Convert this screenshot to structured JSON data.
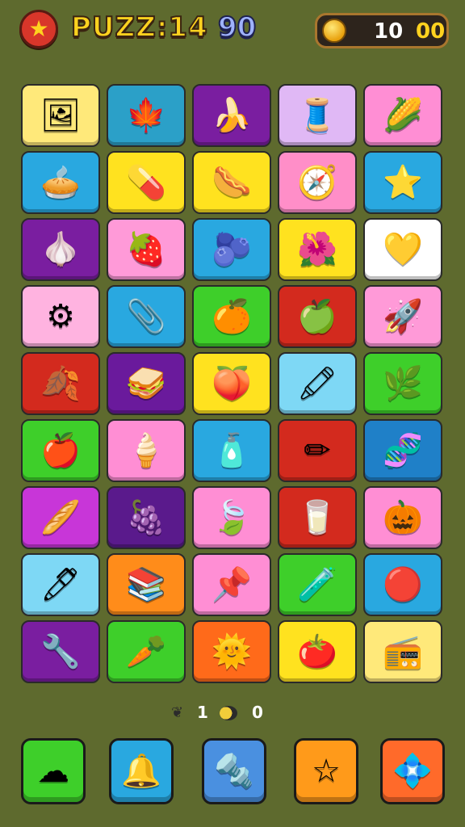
{
  "header": {
    "title": "PUZZ:14",
    "level": "90",
    "coins_main": "10",
    "coins_extra": "00",
    "badge_icon": "★"
  },
  "grid": [
    [
      {
        "icon": "picture-frame-icon",
        "glyph": "🖼",
        "bg": "#ffe97a"
      },
      {
        "icon": "red-leaf-icon",
        "glyph": "🍁",
        "bg": "#2ba0c8"
      },
      {
        "icon": "banana-icon",
        "glyph": "🍌",
        "bg": "#7a1ea0"
      },
      {
        "icon": "rolling-pin-icon",
        "glyph": "🧵",
        "bg": "#e0b8f5"
      },
      {
        "icon": "corn-icon",
        "glyph": "🌽",
        "bg": "#ff8ed4"
      }
    ],
    [
      {
        "icon": "pie-icon",
        "glyph": "🥧",
        "bg": "#29a8e0"
      },
      {
        "icon": "capsule-icon",
        "glyph": "💊",
        "bg": "#ffe21f"
      },
      {
        "icon": "sausage-icon",
        "glyph": "🌭",
        "bg": "#ffe21f"
      },
      {
        "icon": "compass-icon",
        "glyph": "🧭",
        "bg": "#ff8ec8"
      },
      {
        "icon": "star-icon",
        "glyph": "⭐",
        "bg": "#29a8e0"
      }
    ],
    [
      {
        "icon": "garlic-icon",
        "glyph": "🧄",
        "bg": "#7a1ea0"
      },
      {
        "icon": "berry-plate-icon",
        "glyph": "🍓",
        "bg": "#ff9ad8"
      },
      {
        "icon": "berries-branch-icon",
        "glyph": "🫐",
        "bg": "#29a8e0"
      },
      {
        "icon": "flower-icon",
        "glyph": "🌺",
        "bg": "#ffe21f"
      },
      {
        "icon": "heart-icon",
        "glyph": "💛",
        "bg": "#ffffff"
      }
    ],
    [
      {
        "icon": "gear-icon",
        "glyph": "⚙",
        "bg": "#ffb3e0"
      },
      {
        "icon": "stapler-icon",
        "glyph": "📎",
        "bg": "#29a8e0"
      },
      {
        "icon": "orange-icon",
        "glyph": "🍊",
        "bg": "#3ecf2a"
      },
      {
        "icon": "apple-icon",
        "glyph": "🍏",
        "bg": "#d32a1e"
      },
      {
        "icon": "rocket-icon",
        "glyph": "🚀",
        "bg": "#ff9ad8"
      }
    ],
    [
      {
        "icon": "leaf-icon",
        "glyph": "🍂",
        "bg": "#d32a1e"
      },
      {
        "icon": "sandwich-icon",
        "glyph": "🥪",
        "bg": "#6a1a9c"
      },
      {
        "icon": "peach-icon",
        "glyph": "🍑",
        "bg": "#ffe21f"
      },
      {
        "icon": "chalk-icon",
        "glyph": "🖍",
        "bg": "#7ed8f5"
      },
      {
        "icon": "herb-icon",
        "glyph": "🌿",
        "bg": "#3ecf2a"
      }
    ],
    [
      {
        "icon": "red-apple-icon",
        "glyph": "🍎",
        "bg": "#3ecf2a"
      },
      {
        "icon": "cone-icon",
        "glyph": "🍦",
        "bg": "#ff8ed4"
      },
      {
        "icon": "tube-icon",
        "glyph": "🧴",
        "bg": "#29a8e0"
      },
      {
        "icon": "pencil-icon",
        "glyph": "✏",
        "bg": "#d32a1e"
      },
      {
        "icon": "molecule-icon",
        "glyph": "🧬",
        "bg": "#1f80c8"
      }
    ],
    [
      {
        "icon": "rolling-pin-red-icon",
        "glyph": "🥖",
        "bg": "#c836d8"
      },
      {
        "icon": "plum-icon",
        "glyph": "🍇",
        "bg": "#5a1a8c"
      },
      {
        "icon": "green-leaf-icon",
        "glyph": "🍃",
        "bg": "#ff8ed4"
      },
      {
        "icon": "milk-carton-icon",
        "glyph": "🥛",
        "bg": "#d32a1e"
      },
      {
        "icon": "squash-icon",
        "glyph": "🎃",
        "bg": "#ff8ed4"
      }
    ],
    [
      {
        "icon": "crayon-icon",
        "glyph": "🖊",
        "bg": "#7ed8f5"
      },
      {
        "icon": "book-stack-icon",
        "glyph": "📚",
        "bg": "#ff8c1a"
      },
      {
        "icon": "pin-icon",
        "glyph": "📌",
        "bg": "#ff8ed4"
      },
      {
        "icon": "potion-icon",
        "glyph": "🧪",
        "bg": "#3ecf2a"
      },
      {
        "icon": "sun-burst-icon",
        "glyph": "🔴",
        "bg": "#29a8e0"
      }
    ],
    [
      {
        "icon": "wrench-icon",
        "glyph": "🔧",
        "bg": "#7a1ea0"
      },
      {
        "icon": "carrot-icon",
        "glyph": "🥕",
        "bg": "#3ecf2a"
      },
      {
        "icon": "sun-icon",
        "glyph": "🌞",
        "bg": "#ff6a1a"
      },
      {
        "icon": "tomato-icon",
        "glyph": "🍅",
        "bg": "#ffe21f"
      },
      {
        "icon": "radio-icon",
        "glyph": "📻",
        "bg": "#ffe97a"
      }
    ]
  ],
  "status": {
    "count_left": "1",
    "count_right": "0"
  },
  "bottom_bar": [
    {
      "icon": "cotton-icon",
      "glyph": "☁",
      "bg": "#3ecf2a"
    },
    {
      "icon": "whistle-icon",
      "glyph": "🔔",
      "bg": "#29a8e0"
    },
    {
      "icon": "drill-icon",
      "glyph": "🔩",
      "bg": "#4a90e0"
    },
    {
      "icon": "star-icon",
      "glyph": "☆",
      "bg": "#ff9a1a"
    },
    {
      "icon": "diamond-icon",
      "glyph": "💠",
      "bg": "#ff6a2a"
    }
  ]
}
